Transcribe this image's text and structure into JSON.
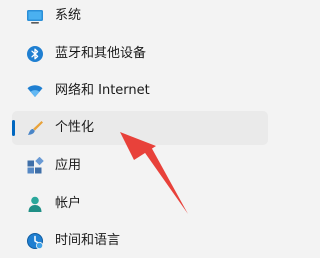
{
  "nav": {
    "items": [
      {
        "label": "系统",
        "icon": "display-icon",
        "selected": false
      },
      {
        "label": "蓝牙和其他设备",
        "icon": "bluetooth-icon",
        "selected": false
      },
      {
        "label": "网络和 Internet",
        "icon": "wifi-icon",
        "selected": false
      },
      {
        "label": "个性化",
        "icon": "brush-icon",
        "selected": true
      },
      {
        "label": "应用",
        "icon": "apps-icon",
        "selected": false
      },
      {
        "label": "帐户",
        "icon": "person-icon",
        "selected": false
      },
      {
        "label": "时间和语言",
        "icon": "clock-globe-icon",
        "selected": false
      }
    ]
  },
  "colors": {
    "accent": "#0067c0",
    "annotation_arrow": "#e8413a",
    "selected_background": "#eaeaea"
  }
}
